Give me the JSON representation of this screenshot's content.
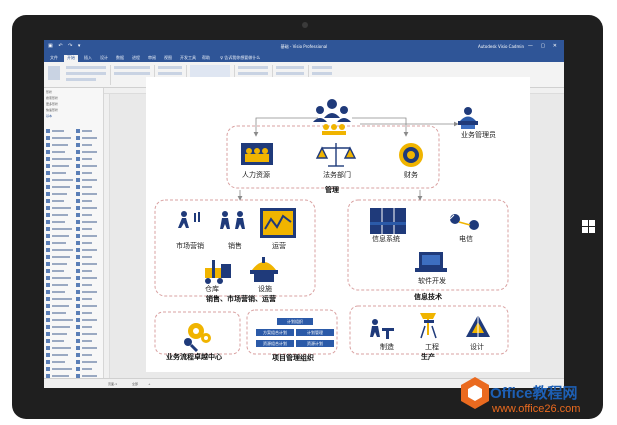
{
  "app": {
    "title": "基础 - Visio Professional",
    "user": "Autodesk Visio Cadmin",
    "window_controls": "— ▢ ✕",
    "qat": "▣ ↶ ↷ ▾"
  },
  "ribbon": {
    "tabs": [
      "文件",
      "开始",
      "插入",
      "设计",
      "数据",
      "进程",
      "审阅",
      "视图",
      "开发工具",
      "帮助",
      "♀ 告诉我你想要做什么"
    ]
  },
  "shapes_panel": {
    "headers": [
      "形状",
      "搜索形状",
      "更多形状",
      "快速形状",
      "基本"
    ]
  },
  "status": {
    "page_label": "页面-1",
    "all_label": "全部",
    "add_label": "+"
  },
  "diagram": {
    "top_right": "业务管理员",
    "mgmt": {
      "hr": "人力资源",
      "legal": "法务部门",
      "finance": "财务",
      "title": "管理"
    },
    "sales": {
      "marketing": "市场营销",
      "sell": "销售",
      "ops": "运营",
      "warehouse": "仓库",
      "facility": "设施",
      "title": "销售、市场营销、运营"
    },
    "it": {
      "system": "信息系统",
      "telecom": "电信",
      "dev": "软件开发",
      "title": "信息技术"
    },
    "bottom_left": {
      "title": "业务流程卓越中心"
    },
    "pmo": {
      "chips": [
        "计划组织",
        "方案组合计划",
        "计划管理",
        "资源组合计划",
        "资源计划"
      ],
      "title": "项目管理组织"
    },
    "prod": {
      "manufacturing": "制造",
      "engineering": "工程",
      "design": "设计",
      "title": "生产"
    }
  },
  "watermark": {
    "line1": "Office教程网",
    "line2": "www.office26.com"
  },
  "colors": {
    "accent": "#2f5597",
    "navy": "#1f3a7a",
    "gold": "#f0b400",
    "dashed": "#d9a0a0"
  }
}
